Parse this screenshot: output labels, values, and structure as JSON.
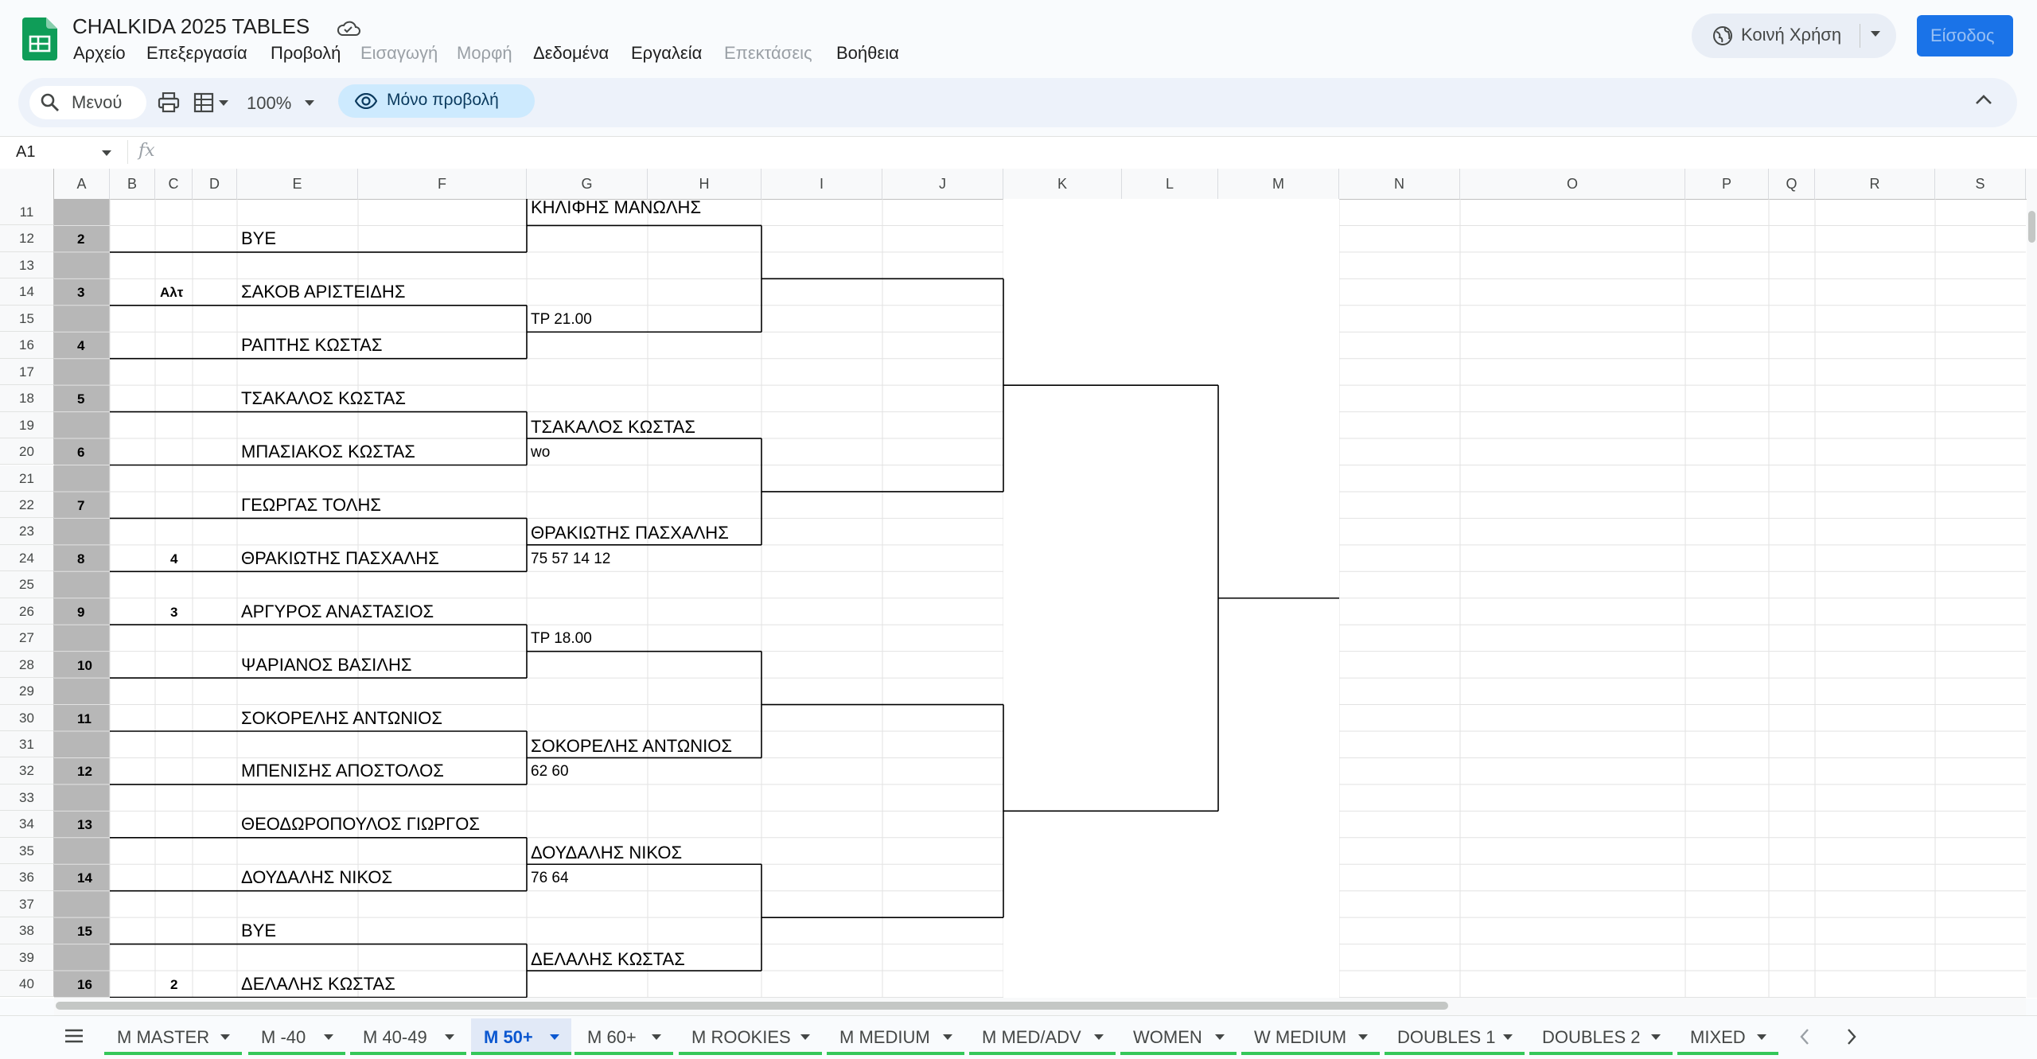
{
  "doc": {
    "title": "CHALKIDA 2025 TABLES"
  },
  "menu": [
    "Αρχείο",
    "Επεξεργασία",
    "Προβολή",
    "Εισαγωγή",
    "Μορφή",
    "Δεδομένα",
    "Εργαλεία",
    "Επεκτάσεις",
    "Βοήθεια"
  ],
  "menu_disabled": [
    false,
    false,
    false,
    true,
    true,
    false,
    false,
    true,
    false
  ],
  "share": {
    "label": "Κοινή Χρήση"
  },
  "signin": {
    "label": "Είσοδος"
  },
  "toolbar": {
    "menu_search": "Μενού",
    "zoom": "100%",
    "view_only": "Μόνο προβολή"
  },
  "formula": {
    "namebox": "A1",
    "fx": "fx"
  },
  "columns": [
    "A",
    "B",
    "C",
    "D",
    "E",
    "F",
    "G",
    "H",
    "I",
    "J",
    "K",
    "L",
    "M",
    "N",
    "O",
    "P",
    "Q",
    "R",
    "S"
  ],
  "rows": [
    "11",
    "12",
    "13",
    "14",
    "15",
    "16",
    "17",
    "18",
    "19",
    "20",
    "21",
    "22",
    "23",
    "24",
    "25",
    "26",
    "27",
    "28",
    "29",
    "30",
    "31",
    "32",
    "33",
    "34",
    "35",
    "36",
    "37",
    "38",
    "39",
    "40"
  ],
  "draw": {
    "seeds": [
      "2",
      "3",
      "4",
      "5",
      "6",
      "7",
      "8",
      "9",
      "10",
      "11",
      "12",
      "13",
      "14",
      "15",
      "16"
    ],
    "seed_notes": [
      "Αλτ",
      "4",
      "3",
      "2"
    ],
    "round1": [
      "BYE",
      "ΣΑΚΟΒ ΑΡΙΣΤΕΙΔΗΣ",
      "ΡΑΠΤΗΣ ΚΩΣΤΑΣ",
      "ΤΣΑΚΑΛΟΣ ΚΩΣΤΑΣ",
      "ΜΠΑΣΙΑΚΟΣ ΚΩΣΤΑΣ",
      "ΓΕΩΡΓΑΣ ΤΟΛΗΣ",
      "ΘΡΑΚΙΩΤΗΣ ΠΑΣΧΑΛΗΣ",
      "ΑΡΓΥΡΟΣ ΑΝΑΣΤΑΣΙΟΣ",
      "ΨΑΡΙΑΝΟΣ ΒΑΣΙΛΗΣ",
      "ΣΟΚΟΡΕΛΗΣ ΑΝΤΩΝΙΟΣ",
      "ΜΠΕΝΙΣΗΣ ΑΠΟΣΤΟΛΟΣ",
      "ΘΕΟΔΩΡΟΠΟΥΛΟΣ ΓΙΩΡΓΟΣ",
      "ΔΟΥΔΑΛΗΣ ΝΙΚΟΣ",
      "BYE",
      "ΔΕΛΑΛΗΣ ΚΩΣΤΑΣ"
    ],
    "round2": [
      "ΚΗΛΙΦΗΣ ΜΑΝΩΛΗΣ",
      "ΤΣΑΚΑΛΟΣ ΚΩΣΤΑΣ",
      "ΘΡΑΚΙΩΤΗΣ ΠΑΣΧΑΛΗΣ",
      "ΣΟΚΟΡΕΛΗΣ ΑΝΤΩΝΙΟΣ",
      "ΔΟΥΔΑΛΗΣ ΝΙΚΟΣ",
      "ΔΕΛΑΛΗΣ ΚΩΣΤΑΣ"
    ],
    "scores": [
      "TP 21.00",
      "wo",
      "75 57 14 12",
      "TP 18.00",
      "62 60",
      "76 64"
    ]
  },
  "sheets": [
    "M MASTER",
    "M -40",
    "M 40-49",
    "M 50+",
    "M 60+",
    "M ROOKIES",
    "M MEDIUM",
    "M MED/ADV",
    "WOMEN",
    "W MEDIUM",
    "DOUBLES 1",
    "DOUBLES 2",
    "MIXED"
  ],
  "active_sheet": "M 50+",
  "colors": {
    "accent": "#0b57d0",
    "tab_underline": "#34c759",
    "sheets_green": "#0f9d58"
  }
}
